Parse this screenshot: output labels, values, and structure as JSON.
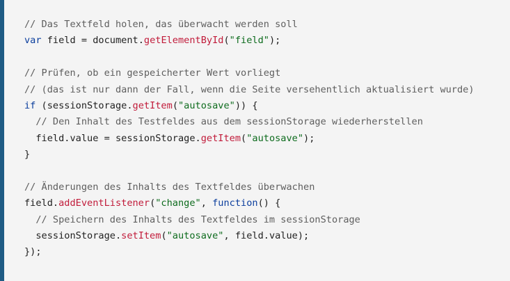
{
  "colors": {
    "background": "#f4f4f4",
    "accent_border": "#1f5b84",
    "comment": "#5e5e5e",
    "keyword": "#0b3e9d",
    "function": "#c11b3a",
    "string": "#0d6b1d",
    "text": "#1f1f1f"
  },
  "code": {
    "lines": [
      [
        {
          "t": "comment",
          "v": "// Das Textfeld holen, das überwacht werden soll"
        }
      ],
      [
        {
          "t": "keyword",
          "v": "var"
        },
        {
          "t": "default",
          "v": " field = document."
        },
        {
          "t": "function",
          "v": "getElementById"
        },
        {
          "t": "default",
          "v": "("
        },
        {
          "t": "string",
          "v": "\"field\""
        },
        {
          "t": "default",
          "v": ");"
        }
      ],
      [],
      [
        {
          "t": "comment",
          "v": "// Prüfen, ob ein gespeicherter Wert vorliegt"
        }
      ],
      [
        {
          "t": "comment",
          "v": "// (das ist nur dann der Fall, wenn die Seite versehentlich aktualisiert wurde)"
        }
      ],
      [
        {
          "t": "keyword",
          "v": "if"
        },
        {
          "t": "default",
          "v": " (sessionStorage."
        },
        {
          "t": "function",
          "v": "getItem"
        },
        {
          "t": "default",
          "v": "("
        },
        {
          "t": "string",
          "v": "\"autosave\""
        },
        {
          "t": "default",
          "v": ")) {"
        }
      ],
      [
        {
          "t": "default",
          "v": "  "
        },
        {
          "t": "comment",
          "v": "// Den Inhalt des Testfeldes aus dem sessionStorage wiederherstellen"
        }
      ],
      [
        {
          "t": "default",
          "v": "  field.value = sessionStorage."
        },
        {
          "t": "function",
          "v": "getItem"
        },
        {
          "t": "default",
          "v": "("
        },
        {
          "t": "string",
          "v": "\"autosave\""
        },
        {
          "t": "default",
          "v": ");"
        }
      ],
      [
        {
          "t": "default",
          "v": "}"
        }
      ],
      [],
      [
        {
          "t": "comment",
          "v": "// Änderungen des Inhalts des Textfeldes überwachen"
        }
      ],
      [
        {
          "t": "default",
          "v": "field."
        },
        {
          "t": "function",
          "v": "addEventListener"
        },
        {
          "t": "default",
          "v": "("
        },
        {
          "t": "string",
          "v": "\"change\""
        },
        {
          "t": "default",
          "v": ", "
        },
        {
          "t": "keyword",
          "v": "function"
        },
        {
          "t": "default",
          "v": "() {"
        }
      ],
      [
        {
          "t": "default",
          "v": "  "
        },
        {
          "t": "comment",
          "v": "// Speichern des Inhalts des Textfeldes im sessionStorage"
        }
      ],
      [
        {
          "t": "default",
          "v": "  sessionStorage."
        },
        {
          "t": "function",
          "v": "setItem"
        },
        {
          "t": "default",
          "v": "("
        },
        {
          "t": "string",
          "v": "\"autosave\""
        },
        {
          "t": "default",
          "v": ", field.value);"
        }
      ],
      [
        {
          "t": "default",
          "v": "});"
        }
      ]
    ]
  }
}
